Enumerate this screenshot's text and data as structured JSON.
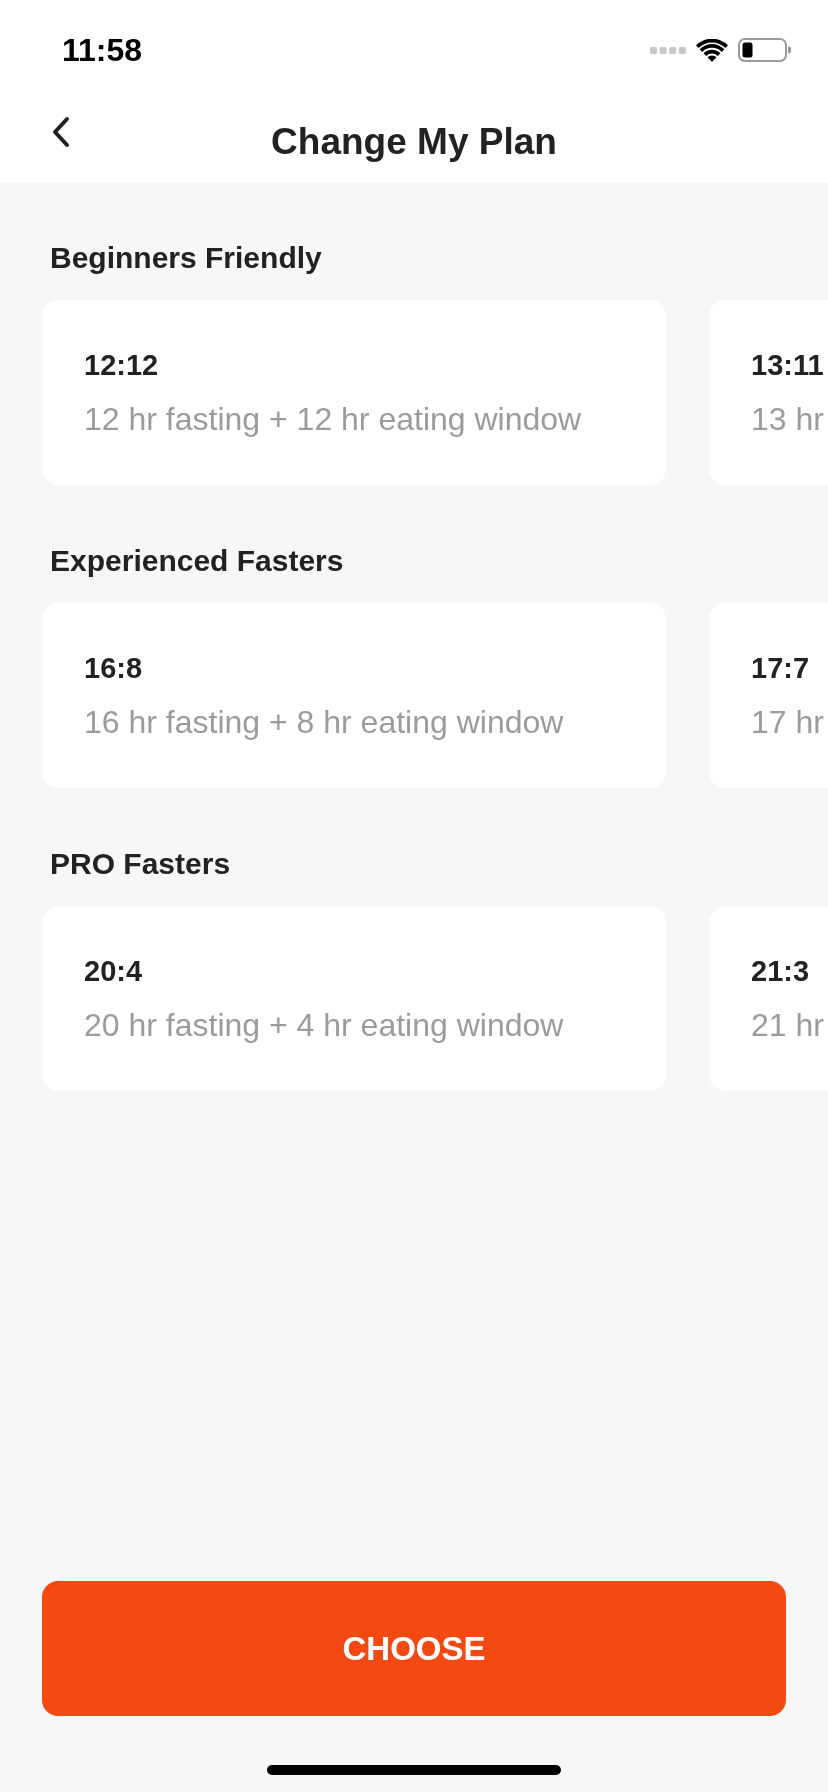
{
  "status_bar": {
    "time": "11:58"
  },
  "header": {
    "title": "Change My Plan"
  },
  "sections": [
    {
      "title": "Beginners Friendly",
      "plans": [
        {
          "name": "12:12",
          "description": "12 hr fasting + 12 hr eating window"
        },
        {
          "name": "13:11",
          "description": "13 hr"
        }
      ]
    },
    {
      "title": "Experienced Fasters",
      "plans": [
        {
          "name": "16:8",
          "description": "16 hr fasting + 8 hr eating window"
        },
        {
          "name": "17:7",
          "description": "17 hr"
        }
      ]
    },
    {
      "title": "PRO Fasters",
      "plans": [
        {
          "name": "20:4",
          "description": "20 hr fasting + 4 hr eating window"
        },
        {
          "name": "21:3",
          "description": "21 hr"
        }
      ]
    }
  ],
  "button": {
    "label": "CHOOSE"
  }
}
